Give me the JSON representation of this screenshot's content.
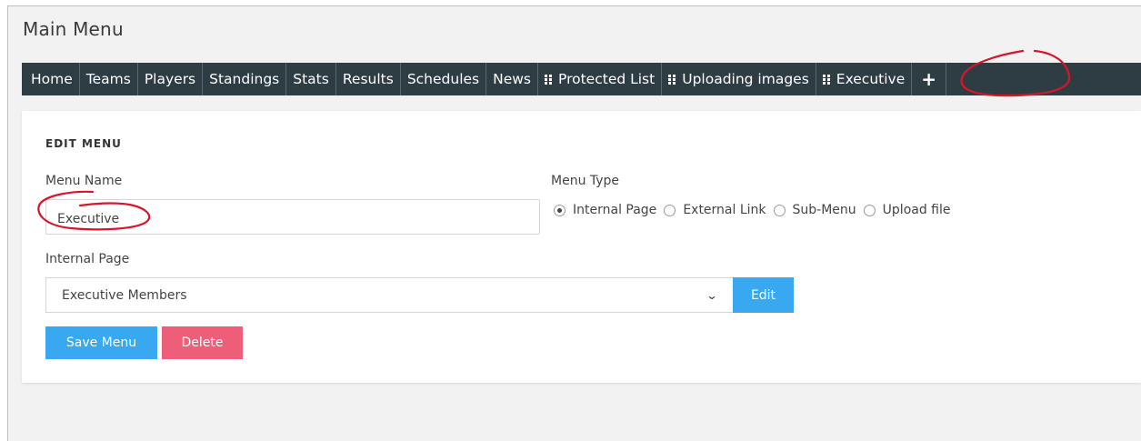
{
  "page": {
    "title": "Main Menu"
  },
  "navbar": {
    "items": [
      {
        "label": "Home",
        "has_grip": false
      },
      {
        "label": "Teams",
        "has_grip": false
      },
      {
        "label": "Players",
        "has_grip": false
      },
      {
        "label": "Standings",
        "has_grip": false
      },
      {
        "label": "Stats",
        "has_grip": false
      },
      {
        "label": "Results",
        "has_grip": false
      },
      {
        "label": "Schedules",
        "has_grip": false
      },
      {
        "label": "News",
        "has_grip": false
      },
      {
        "label": "Protected List",
        "has_grip": true
      },
      {
        "label": "Uploading images",
        "has_grip": true
      },
      {
        "label": "Executive",
        "has_grip": true
      }
    ],
    "add_label": "+",
    "grip_icon": "drag-grip-icon"
  },
  "edit_menu": {
    "heading": "EDIT MENU",
    "menu_name_label": "Menu Name",
    "menu_name_value": "Executive",
    "menu_type_label": "Menu Type",
    "menu_type_options": [
      {
        "label": "Internal Page",
        "selected": true
      },
      {
        "label": "External Link",
        "selected": false
      },
      {
        "label": "Sub-Menu",
        "selected": false
      },
      {
        "label": "Upload file",
        "selected": false
      }
    ],
    "internal_page_label": "Internal Page",
    "internal_page_selected": "Executive Members",
    "edit_label": "Edit",
    "save_label": "Save Menu",
    "delete_label": "Delete"
  },
  "colors": {
    "navbar_bg": "#2e3c44",
    "primary_button": "#38a9f0",
    "delete_button": "#ee5e78",
    "annotation_red": "#d9152a"
  }
}
